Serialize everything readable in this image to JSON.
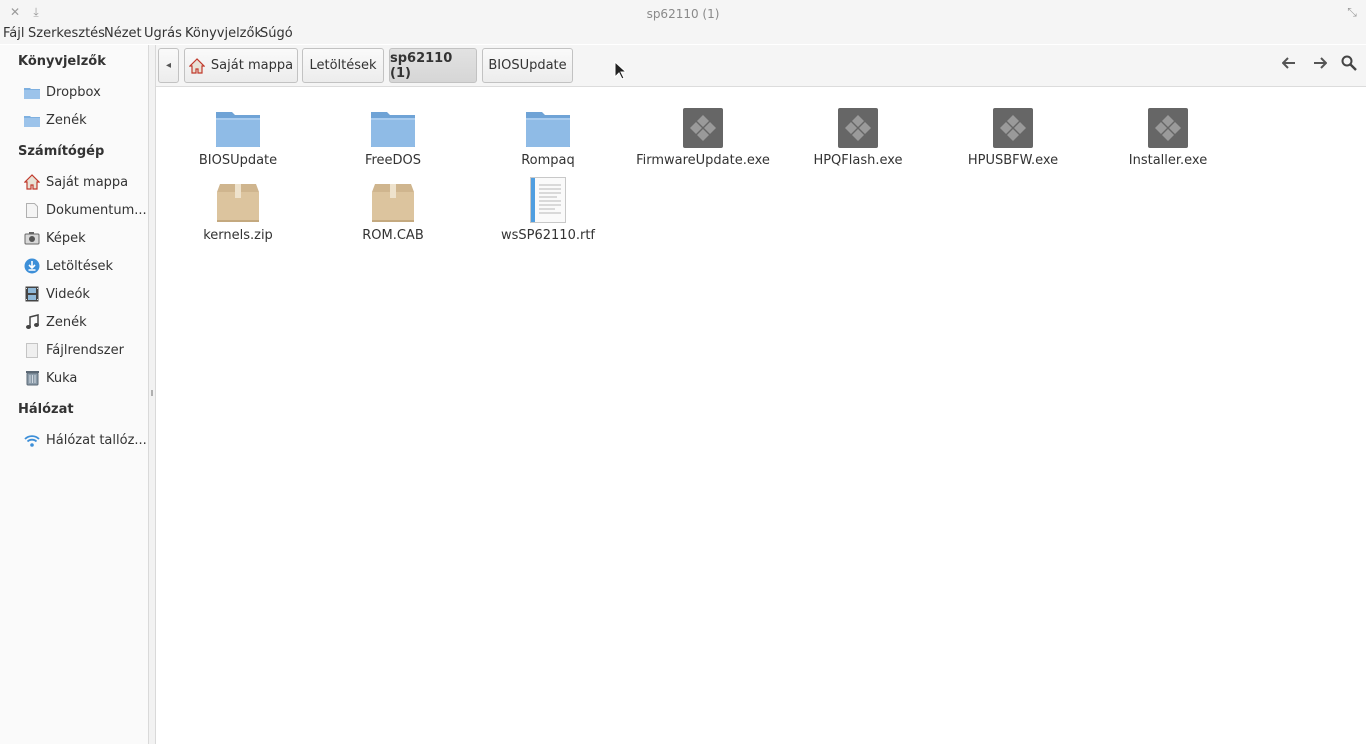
{
  "window": {
    "title": "sp62110 (1)",
    "close_glyph": "✕",
    "download_glyph": "⤓",
    "restore_glyph": "⤡"
  },
  "menu": [
    "Fájl",
    "Szerkesztés",
    "Nézet",
    "Ugrás",
    "Könyvjelzők",
    "Súgó"
  ],
  "sidebar": {
    "sections": [
      {
        "heading": "Könyvjelzők",
        "items": [
          {
            "label": "Dropbox",
            "icon": "folder-icon"
          },
          {
            "label": "Zenék",
            "icon": "folder-icon"
          }
        ]
      },
      {
        "heading": "Számítógép",
        "items": [
          {
            "label": "Saját mappa",
            "icon": "home-icon"
          },
          {
            "label": "Dokumentum...",
            "icon": "document-icon"
          },
          {
            "label": "Képek",
            "icon": "camera-icon"
          },
          {
            "label": "Letöltések",
            "icon": "download-icon"
          },
          {
            "label": "Videók",
            "icon": "film-icon"
          },
          {
            "label": "Zenék",
            "icon": "music-note-icon"
          },
          {
            "label": "Fájlrendszer",
            "icon": "drive-icon"
          },
          {
            "label": "Kuka",
            "icon": "trash-icon"
          }
        ]
      },
      {
        "heading": "Hálózat",
        "items": [
          {
            "label": "Hálózat tallóz...",
            "icon": "wifi-icon"
          }
        ]
      }
    ]
  },
  "breadcrumbs": [
    {
      "label": "Saját mappa",
      "icon": "home-icon",
      "active": false
    },
    {
      "label": "Letöltések",
      "active": false
    },
    {
      "label": "sp62110 (1)",
      "active": true
    },
    {
      "label": "BIOSUpdate",
      "active": false
    }
  ],
  "toolbar": {
    "back_glyph": "🡐",
    "forward_glyph": "🡒",
    "search_glyph": "🔍",
    "scroll_left_glyph": "◂"
  },
  "files": [
    {
      "name": "BIOSUpdate",
      "icon": "folder-icon"
    },
    {
      "name": "FreeDOS",
      "icon": "folder-icon"
    },
    {
      "name": "Rompaq",
      "icon": "folder-icon"
    },
    {
      "name": "FirmwareUpdate.exe",
      "icon": "executable-icon"
    },
    {
      "name": "HPQFlash.exe",
      "icon": "executable-icon"
    },
    {
      "name": "HPUSBFW.exe",
      "icon": "executable-icon"
    },
    {
      "name": "Installer.exe",
      "icon": "executable-icon"
    },
    {
      "name": "kernels.zip",
      "icon": "archive-icon"
    },
    {
      "name": "ROM.CAB",
      "icon": "archive-icon"
    },
    {
      "name": "wsSP62110.rtf",
      "icon": "text-document-icon"
    }
  ],
  "colors": {
    "folder": "#7eb0e0",
    "exe": "#6e6e6e",
    "archive": "#d9bf96"
  }
}
